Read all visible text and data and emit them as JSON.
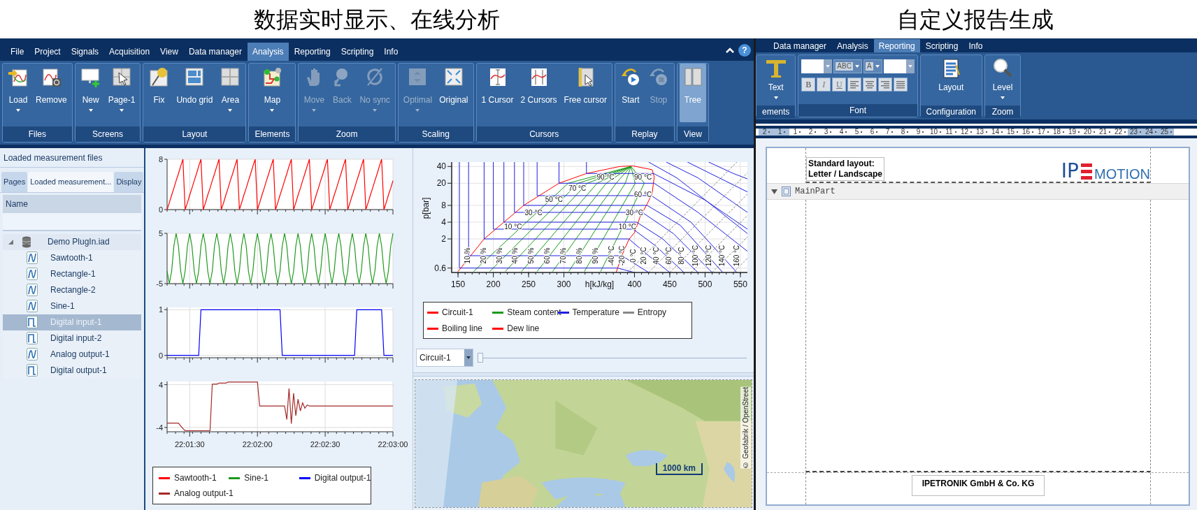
{
  "captions": [
    "数据实时显示、在线分析",
    "自定义报告生成"
  ],
  "analysis_window": {
    "menu": [
      {
        "label": "File",
        "selected": false
      },
      {
        "label": "Project",
        "selected": false
      },
      {
        "label": "Signals",
        "selected": false
      },
      {
        "label": "Acquisition",
        "selected": false
      },
      {
        "label": "View",
        "selected": false
      },
      {
        "label": "Data manager",
        "selected": false
      },
      {
        "label": "Analysis",
        "selected": true
      },
      {
        "label": "Reporting",
        "selected": false
      },
      {
        "label": "Scripting",
        "selected": false
      },
      {
        "label": "Info",
        "selected": false
      }
    ],
    "help": "?",
    "ribbon_groups": [
      {
        "label": "Files",
        "buttons": [
          {
            "label": "Load",
            "kind": "load",
            "dropdown": true,
            "disabled": false,
            "pressed": false
          },
          {
            "label": "Remove",
            "kind": "remove",
            "dropdown": false,
            "disabled": false,
            "pressed": false
          }
        ]
      },
      {
        "label": "Screens",
        "buttons": [
          {
            "label": "New",
            "kind": "new",
            "dropdown": true,
            "disabled": false,
            "pressed": false
          },
          {
            "label": "Page-1",
            "kind": "page",
            "dropdown": true,
            "disabled": false,
            "pressed": false
          }
        ]
      },
      {
        "label": "Layout",
        "buttons": [
          {
            "label": "Fix",
            "kind": "fix",
            "dropdown": false,
            "disabled": false,
            "pressed": false
          },
          {
            "label": "Undo grid",
            "kind": "undogrid",
            "dropdown": false,
            "disabled": false,
            "pressed": false
          },
          {
            "label": "Area",
            "kind": "area",
            "dropdown": true,
            "disabled": false,
            "pressed": false
          }
        ]
      },
      {
        "label": "Elements",
        "buttons": [
          {
            "label": "Map",
            "kind": "map",
            "dropdown": true,
            "disabled": false,
            "pressed": false
          }
        ]
      },
      {
        "label": "Zoom",
        "buttons": [
          {
            "label": "Move",
            "kind": "move",
            "dropdown": true,
            "disabled": true,
            "pressed": false
          },
          {
            "label": "Back",
            "kind": "back",
            "dropdown": false,
            "disabled": true,
            "pressed": false
          },
          {
            "label": "No sync",
            "kind": "nosync",
            "dropdown": true,
            "disabled": true,
            "pressed": false
          }
        ]
      },
      {
        "label": "Scaling",
        "buttons": [
          {
            "label": "Optimal",
            "kind": "optimal",
            "dropdown": true,
            "disabled": true,
            "pressed": false
          },
          {
            "label": "Original",
            "kind": "original",
            "dropdown": false,
            "disabled": false,
            "pressed": false
          }
        ]
      },
      {
        "label": "Cursors",
        "buttons": [
          {
            "label": "1 Cursor",
            "kind": "cursor1",
            "dropdown": false,
            "disabled": false,
            "pressed": false
          },
          {
            "label": "2 Cursors",
            "kind": "cursor2",
            "dropdown": false,
            "disabled": false,
            "pressed": false
          },
          {
            "label": "Free cursor",
            "kind": "freecursor",
            "dropdown": false,
            "disabled": false,
            "pressed": false
          }
        ]
      },
      {
        "label": "Replay",
        "buttons": [
          {
            "label": "Start",
            "kind": "start",
            "dropdown": false,
            "disabled": false,
            "pressed": false
          },
          {
            "label": "Stop",
            "kind": "stop",
            "dropdown": false,
            "disabled": true,
            "pressed": false
          }
        ]
      },
      {
        "label": "View",
        "buttons": [
          {
            "label": "Tree",
            "kind": "tree",
            "dropdown": false,
            "disabled": false,
            "pressed": true
          }
        ]
      }
    ],
    "files_panel": {
      "title": "Loaded measurement files",
      "tabs": [
        {
          "label": "Pages",
          "selected": false
        },
        {
          "label": "Loaded measurement...",
          "selected": true
        },
        {
          "label": "Display",
          "selected": false
        }
      ],
      "column": "Name",
      "tree": [
        {
          "label": "Demo PlugIn.iad",
          "kind": "database",
          "expanded": true,
          "selected": false,
          "children": [
            {
              "label": "Sawtooth-1",
              "kind": "analog",
              "selected": false
            },
            {
              "label": "Rectangle-1",
              "kind": "analog",
              "selected": false
            },
            {
              "label": "Rectangle-2",
              "kind": "analog",
              "selected": false
            },
            {
              "label": "Sine-1",
              "kind": "analog",
              "selected": false
            },
            {
              "label": "Digital input-1",
              "kind": "digital",
              "selected": true
            },
            {
              "label": "Digital input-2",
              "kind": "digital",
              "selected": false
            },
            {
              "label": "Analog output-1",
              "kind": "analog",
              "selected": false
            },
            {
              "label": "Digital output-1",
              "kind": "digital",
              "selected": false
            }
          ]
        }
      ]
    },
    "time_charts": [
      {
        "chart_data": {
          "type": "line",
          "grid": true,
          "ylim": [
            0,
            8
          ],
          "yticks": [
            0,
            8
          ],
          "categories": [
            null,
            null,
            null,
            null,
            null,
            null,
            null,
            null,
            null,
            null,
            null,
            null,
            null,
            null,
            null,
            null,
            null,
            null,
            null,
            null,
            null,
            null,
            null,
            null,
            null,
            null,
            null,
            null,
            null,
            null,
            null,
            null,
            null,
            null,
            null,
            null,
            null,
            null,
            null,
            null,
            null,
            null,
            null,
            null,
            null,
            null,
            null,
            null,
            null,
            null,
            null,
            null,
            null,
            null,
            null,
            null,
            null,
            null,
            null,
            null,
            null,
            null,
            null,
            null,
            null,
            null,
            null,
            null,
            null,
            null,
            null,
            null,
            null,
            null,
            null,
            null,
            null,
            null,
            null,
            null,
            null,
            null,
            null,
            null,
            null,
            null,
            null,
            null,
            null,
            null,
            null,
            null,
            null,
            null,
            null,
            null,
            null,
            null,
            null,
            null,
            null
          ],
          "series": [
            {
              "name": "Sawtooth-1",
              "color": "#ff0000",
              "values": [
                0,
                1.1,
                2.3,
                3.4,
                4.6,
                5.7,
                6.9,
                8,
                0,
                1.1,
                2.3,
                3.4,
                4.6,
                5.7,
                6.9,
                8,
                0,
                1.1,
                2.3,
                3.4,
                4.6,
                5.7,
                6.9,
                8,
                0,
                1.1,
                2.3,
                3.4,
                4.6,
                5.7,
                6.9,
                8,
                0,
                1.1,
                2.3,
                3.4,
                4.6,
                5.7,
                6.9,
                8,
                0,
                1.1,
                2.3,
                3.4,
                4.6,
                5.7,
                6.9,
                8,
                0,
                1.1,
                2.3,
                3.4,
                4.6,
                5.7,
                6.9,
                8,
                0,
                1.1,
                2.3,
                3.4,
                4.6,
                5.7,
                6.9,
                8,
                0,
                1.1,
                2.3,
                3.4,
                4.6,
                5.7,
                6.9,
                8,
                0,
                1.1,
                2.3,
                3.4,
                4.6,
                5.7,
                6.9,
                8,
                0,
                1.1,
                2.3,
                3.4,
                4.6,
                5.7,
                6.9,
                8,
                0,
                1.1,
                2.3,
                3.4,
                4.6,
                5.7,
                6.9,
                8,
                0,
                1.1,
                2.3,
                3.4,
                4.6
              ]
            }
          ]
        }
      },
      {
        "chart_data": {
          "type": "line",
          "grid": true,
          "ylim": [
            -5,
            5
          ],
          "yticks": [
            -5,
            5
          ],
          "categories": [
            null,
            null,
            null,
            null,
            null,
            null,
            null,
            null,
            null,
            null,
            null,
            null,
            null,
            null,
            null,
            null,
            null,
            null,
            null,
            null,
            null,
            null,
            null,
            null,
            null,
            null,
            null,
            null,
            null,
            null,
            null,
            null,
            null,
            null,
            null,
            null,
            null,
            null,
            null,
            null,
            null,
            null,
            null,
            null,
            null,
            null,
            null,
            null,
            null,
            null,
            null,
            null,
            null,
            null,
            null,
            null,
            null,
            null,
            null,
            null,
            null,
            null,
            null,
            null,
            null,
            null,
            null,
            null,
            null,
            null,
            null,
            null,
            null,
            null,
            null,
            null,
            null,
            null,
            null,
            null,
            null,
            null,
            null,
            null,
            null,
            null,
            null,
            null,
            null,
            null,
            null,
            null,
            null,
            null,
            null,
            null,
            null,
            null,
            null,
            null,
            null
          ],
          "series": [
            {
              "name": "Sine-1",
              "color": "#1e9a1e",
              "values": [
                -2.5,
                -5,
                -2.5,
                2.5,
                5,
                2.5,
                -2.5,
                -5,
                -2.5,
                2.5,
                5,
                2.5,
                -2.5,
                -5,
                -2.5,
                2.5,
                5,
                2.5,
                -2.5,
                -5,
                -2.5,
                2.5,
                5,
                2.5,
                -2.5,
                -5,
                -2.5,
                2.5,
                5,
                2.5,
                -2.5,
                -5,
                -2.5,
                2.5,
                5,
                2.5,
                -2.5,
                -5,
                -2.5,
                2.5,
                5,
                2.5,
                -2.5,
                -5,
                -2.5,
                2.5,
                5,
                2.5,
                -2.5,
                -5,
                -2.5,
                2.5,
                5,
                2.5,
                -2.5,
                -5,
                -2.5,
                2.5,
                5,
                2.5,
                -2.5,
                -5,
                -2.5,
                2.5,
                5,
                2.5,
                -2.5,
                -5,
                -2.5,
                2.5,
                5,
                2.5,
                -2.5,
                -5,
                -2.5,
                2.5,
                5,
                2.5,
                -2.5,
                -5,
                -2.5,
                2.5,
                5,
                2.5,
                -2.5,
                -5,
                -2.5,
                2.5,
                5,
                2.5,
                -2.5,
                -5,
                -2.5,
                2.5,
                5,
                2.5,
                -2.5,
                -5,
                -2.5,
                2.5,
                5
              ]
            }
          ]
        }
      },
      {
        "chart_data": {
          "type": "line",
          "grid": true,
          "ylim": [
            -0.05,
            1.05
          ],
          "yticks": [
            0,
            1
          ],
          "categories": [
            null,
            null,
            null,
            null,
            null,
            null,
            null,
            null,
            null,
            null,
            null,
            null,
            null,
            null,
            null,
            null,
            null,
            null,
            null,
            null,
            null,
            null,
            null,
            null,
            null,
            null,
            null,
            null,
            null,
            null,
            null,
            null,
            null,
            null,
            null,
            null,
            null,
            null,
            null,
            null,
            null,
            null,
            null,
            null,
            null,
            null,
            null,
            null,
            null,
            null,
            null,
            null,
            null,
            null,
            null,
            null,
            null,
            null,
            null,
            null,
            null,
            null,
            null,
            null,
            null,
            null,
            null,
            null,
            null,
            null,
            null,
            null,
            null,
            null,
            null,
            null,
            null,
            null,
            null,
            null,
            null,
            null,
            null,
            null,
            null,
            null,
            null,
            null,
            null,
            null,
            null,
            null,
            null,
            null,
            null,
            null,
            null,
            null,
            null,
            null,
            null
          ],
          "series": [
            {
              "name": "Digital output-1",
              "color": "#0000ff",
              "values": [
                0,
                0,
                0,
                0,
                0,
                0,
                0,
                0,
                0,
                0,
                0,
                0,
                0,
                0,
                0,
                1,
                1,
                1,
                1,
                1,
                1,
                1,
                1,
                1,
                1,
                1,
                1,
                1,
                1,
                1,
                1,
                1,
                1,
                1,
                1,
                1,
                1,
                1,
                1,
                1,
                1,
                1,
                1,
                1,
                1,
                1,
                1,
                1,
                1,
                1,
                1,
                0,
                0,
                0,
                0,
                0,
                0,
                0,
                0,
                0,
                0,
                0,
                0,
                0,
                0,
                0,
                0,
                0,
                0,
                0,
                0,
                0,
                0,
                0,
                0,
                0,
                0,
                0,
                0,
                0,
                0,
                0,
                0,
                0,
                1,
                1,
                1,
                1,
                1,
                1,
                1,
                1,
                1,
                1,
                1,
                1,
                0,
                0,
                0,
                0,
                0
              ]
            }
          ]
        }
      },
      {
        "chart_data": {
          "type": "line",
          "grid": true,
          "ylim": [
            -4.8,
            4.6
          ],
          "yticks": [
            -4,
            4
          ],
          "categories": [
            null,
            null,
            null,
            null,
            null,
            null,
            null,
            null,
            null,
            null,
            "22:01:30",
            null,
            null,
            null,
            null,
            null,
            null,
            null,
            null,
            null,
            null,
            null,
            null,
            null,
            null,
            null,
            null,
            null,
            null,
            null,
            null,
            null,
            null,
            null,
            null,
            null,
            null,
            null,
            null,
            null,
            "22:02:00",
            null,
            null,
            null,
            null,
            null,
            null,
            null,
            null,
            null,
            null,
            null,
            null,
            null,
            null,
            null,
            null,
            null,
            null,
            null,
            null,
            null,
            null,
            null,
            null,
            null,
            null,
            null,
            null,
            null,
            "22:02:30",
            null,
            null,
            null,
            null,
            null,
            null,
            null,
            null,
            null,
            null,
            null,
            null,
            null,
            null,
            null,
            null,
            null,
            null,
            null,
            null,
            null,
            null,
            null,
            null,
            null,
            null,
            null,
            null,
            null,
            "22:03:00"
          ],
          "series": [
            {
              "name": "Analog output-1",
              "color": "#a52a2a",
              "values": [
                -3.2,
                -3.2,
                -3.2,
                -3.2,
                -3.2,
                -3.2,
                -3.7,
                -4.2,
                -4.6,
                -4.6,
                -4.6,
                -4.6,
                -4.6,
                -4.6,
                -4.6,
                -4.6,
                -4.6,
                -4.6,
                -4.6,
                -4.6,
                4.1,
                4.1,
                4.1,
                4.3,
                4.3,
                4.3,
                4.3,
                4.5,
                4.5,
                4.5,
                4.5,
                4.5,
                4.5,
                4.5,
                4.5,
                4.5,
                4.5,
                4.5,
                4.5,
                4.5,
                4.5,
                0,
                0,
                0,
                0,
                0,
                0,
                0,
                0,
                0,
                0,
                0,
                0,
                -2.5,
                3.3,
                -3.3,
                2.4,
                -1.8,
                1.3,
                -0.9,
                0.6,
                -0.4,
                0.2,
                0,
                0,
                0,
                0,
                0,
                0,
                0,
                0,
                0,
                0,
                0,
                0,
                0,
                0,
                0,
                0,
                0,
                0,
                0,
                0,
                0,
                0,
                0,
                0,
                0,
                0,
                0,
                0,
                0,
                0,
                0,
                0,
                0,
                0,
                0,
                0,
                0,
                0
              ]
            }
          ]
        }
      }
    ],
    "ph_diagram": {
      "x_axis_labels": [
        "150",
        "200",
        "250",
        "300",
        "400",
        "450",
        "500",
        "550"
      ],
      "x_axis_title": "h[kJ/kg]",
      "y_axis_title": "p[bar]",
      "y_axis_labels": [
        "40",
        "20",
        "8",
        "4",
        "2",
        "0.6"
      ],
      "curve_labels": [
        "10 °C",
        "30 °C",
        "50 °C",
        "70 °C",
        "90 °C",
        "90 °C",
        "60 °C",
        "30 °C",
        "10 °C",
        "10 %",
        "20 %",
        "30 %",
        "40 %",
        "50 %",
        "60 %",
        "70 %",
        "80 %",
        "90 %",
        "-40 °C",
        "-20 °C",
        "0 °C",
        "20 °C",
        "40 °C",
        "60 °C",
        "80 °C",
        "100 °C",
        "120 °C",
        "140 °C",
        "160 °C"
      ],
      "legend": [
        {
          "name": "Circuit-1",
          "color": "#ff0000"
        },
        {
          "name": "Steam content",
          "color": "#1a9a1a"
        },
        {
          "name": "Temperature",
          "color": "#2020e0"
        },
        {
          "name": "Entropy",
          "color": "#888888"
        },
        {
          "name": "Boiling line",
          "color": "#ff0000"
        },
        {
          "name": "Dew line",
          "color": "#ff0000"
        }
      ]
    },
    "circuit_select": {
      "value": "Circuit-1"
    },
    "circuit_slider": {
      "level": 0
    },
    "map": {
      "kind": "picture",
      "scale": "1000 km",
      "attribution": "© Geofabrik / OpenStreet"
    }
  },
  "report_window": {
    "menu": [
      {
        "label": "Data manager",
        "selected": false
      },
      {
        "label": "Analysis",
        "selected": false
      },
      {
        "label": "Reporting",
        "selected": true
      },
      {
        "label": "Scripting",
        "selected": false
      },
      {
        "label": "Info",
        "selected": false
      }
    ],
    "ribbon_groups": [
      {
        "label": "ements",
        "kind": "buttons",
        "buttons": [
          {
            "label": "Text",
            "kind": "text",
            "dropdown": true
          }
        ]
      },
      {
        "label": "Font",
        "kind": "font",
        "top_tools": [
          {
            "kind": "combo"
          },
          {
            "kind": "color",
            "label": "ABC"
          },
          {
            "kind": "color",
            "label": "A"
          },
          {
            "kind": "combo"
          }
        ],
        "bottom_tools": [
          {
            "kind": "bold",
            "label": "B"
          },
          {
            "kind": "italic",
            "label": "I"
          },
          {
            "kind": "underline",
            "label": "U"
          },
          {
            "kind": "align-left"
          },
          {
            "kind": "align-center"
          },
          {
            "kind": "align-right"
          },
          {
            "kind": "justify"
          }
        ]
      },
      {
        "label": "Configuration",
        "kind": "buttons",
        "buttons": [
          {
            "label": "Layout",
            "kind": "layout",
            "dropdown": false
          }
        ]
      },
      {
        "label": "Zoom",
        "kind": "buttons",
        "buttons": [
          {
            "label": "Level",
            "kind": "level",
            "dropdown": true
          }
        ]
      }
    ],
    "ruler": [
      {
        "label": "2",
        "margin": true
      },
      {
        "label": "1",
        "margin": true
      },
      {
        "label": "1",
        "margin": false
      },
      {
        "label": "2",
        "margin": false
      },
      {
        "label": "3",
        "margin": false
      },
      {
        "label": "4",
        "margin": false
      },
      {
        "label": "5",
        "margin": false
      },
      {
        "label": "6",
        "margin": false
      },
      {
        "label": "7",
        "margin": false
      },
      {
        "label": "8",
        "margin": false
      },
      {
        "label": "9",
        "margin": false
      },
      {
        "label": "10",
        "margin": false
      },
      {
        "label": "11",
        "margin": false
      },
      {
        "label": "12",
        "margin": false
      },
      {
        "label": "13",
        "margin": false
      },
      {
        "label": "14",
        "margin": false
      },
      {
        "label": "15",
        "margin": false
      },
      {
        "label": "16",
        "margin": false
      },
      {
        "label": "17",
        "margin": false
      },
      {
        "label": "18",
        "margin": false
      },
      {
        "label": "19",
        "margin": false
      },
      {
        "label": "20",
        "margin": false
      },
      {
        "label": "21",
        "margin": false
      },
      {
        "label": "22",
        "margin": false
      },
      {
        "label": "23",
        "margin": true
      },
      {
        "label": "24",
        "margin": true
      },
      {
        "label": "25",
        "margin": true
      }
    ],
    "page": {
      "header_lines": [
        "Standard layout:",
        "Letter / Landscape"
      ],
      "logo": {
        "left": "IP",
        "right": "MOTION"
      },
      "band": {
        "label": "MainPart",
        "expanded": true
      },
      "footer": "IPETRONIK GmbH & Co. KG"
    }
  }
}
